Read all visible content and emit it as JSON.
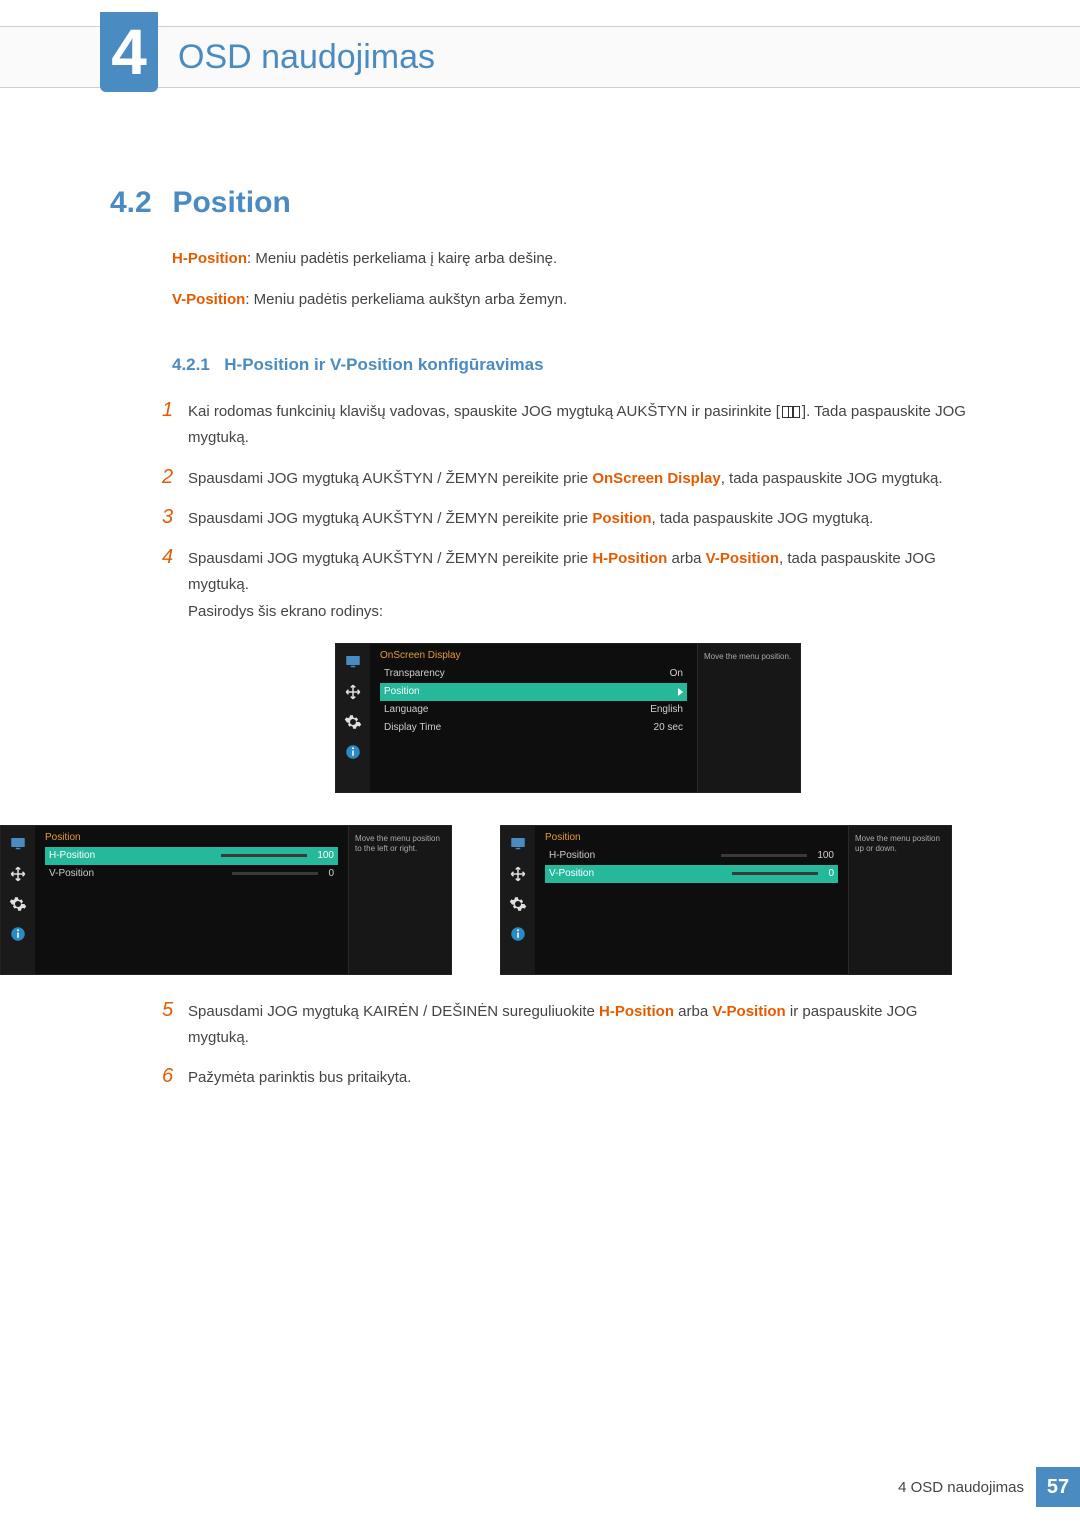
{
  "chapter": {
    "number": "4",
    "title": "OSD naudojimas"
  },
  "section": {
    "number": "4.2",
    "title": "Position"
  },
  "intro": {
    "h": {
      "label": "H-Position",
      "text": ": Meniu padėtis perkeliama į kairę arba dešinę."
    },
    "v": {
      "label": "V-Position",
      "text": ": Meniu padėtis perkeliama aukštyn arba žemyn."
    }
  },
  "subsection": {
    "number": "4.2.1",
    "title": "H-Position ir V-Position konfigūravimas"
  },
  "steps": {
    "s1a": "Kai rodomas funkcinių klavišų vadovas, spauskite JOG mygtuką AUKŠTYN ir pasirinkite [",
    "s1b": "]. Tada paspauskite JOG mygtuką.",
    "s2a": "Spausdami JOG mygtuką AUKŠTYN / ŽEMYN pereikite prie ",
    "s2kw": "OnScreen Display",
    "s2b": ", tada paspauskite JOG mygtuką.",
    "s3a": "Spausdami JOG mygtuką AUKŠTYN / ŽEMYN pereikite prie ",
    "s3kw": "Position",
    "s3b": ", tada paspauskite JOG mygtuką.",
    "s4a": "Spausdami JOG mygtuką AUKŠTYN / ŽEMYN pereikite prie ",
    "s4kw1": "H-Position",
    "s4mid": " arba ",
    "s4kw2": "V-Position",
    "s4b": ", tada paspauskite JOG mygtuką.",
    "s4c": "Pasirodys šis ekrano rodinys:",
    "s5a": "Spausdami JOG mygtuką KAIRĖN / DEŠINĖN sureguliuokite ",
    "s5kw1": "H-Position",
    "s5mid": " arba ",
    "s5kw2": "V-Position",
    "s5b": " ir paspauskite JOG mygtuką.",
    "s6": "Pažymėta parinktis bus pritaikyta.",
    "n1": "1",
    "n2": "2",
    "n3": "3",
    "n4": "4",
    "n5": "5",
    "n6": "6"
  },
  "osd_main": {
    "title": "OnScreen Display",
    "rows": [
      {
        "label": "Transparency",
        "value": "On"
      },
      {
        "label": "Position",
        "value": ""
      },
      {
        "label": "Language",
        "value": "English"
      },
      {
        "label": "Display Time",
        "value": "20 sec"
      }
    ],
    "selected_index": 1,
    "help": "Move the menu position."
  },
  "osd_h": {
    "title": "Position",
    "rows": [
      {
        "label": "H-Position",
        "value": "100",
        "slider": 100
      },
      {
        "label": "V-Position",
        "value": "0",
        "slider": 0
      }
    ],
    "selected_index": 0,
    "help": "Move the menu position to the left or right."
  },
  "osd_v": {
    "title": "Position",
    "rows": [
      {
        "label": "H-Position",
        "value": "100",
        "slider": 100
      },
      {
        "label": "V-Position",
        "value": "0",
        "slider": 0
      }
    ],
    "selected_index": 1,
    "help": "Move the menu position up or down."
  },
  "footer": {
    "label": "4 OSD naudojimas",
    "page": "57"
  },
  "icons": {
    "monitor_color": "#4a8bc2",
    "move_color": "#e0e0e0",
    "gear_color": "#e0e0e0",
    "info_color": "#2b8ac2"
  }
}
